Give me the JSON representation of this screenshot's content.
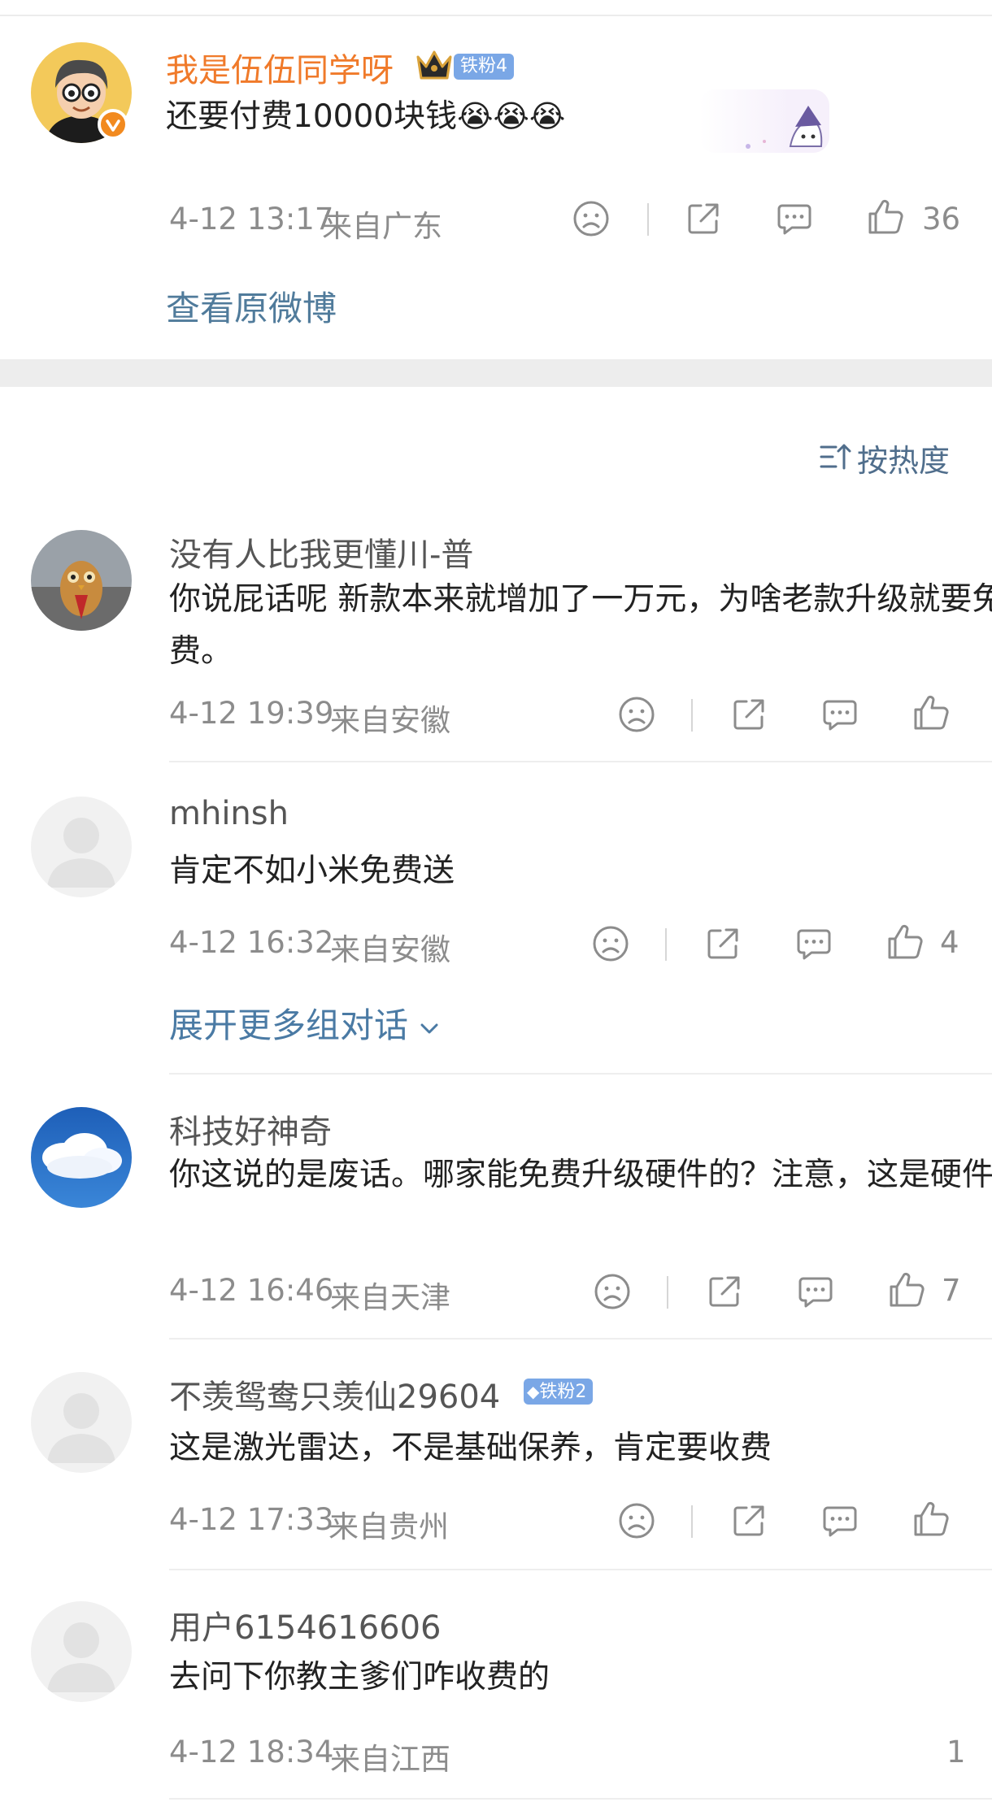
{
  "post": {
    "username": "我是伍伍同学呀",
    "fan_badge": "铁粉4",
    "text": "还要付费10000块钱",
    "emoji": "😭😭😭",
    "time": "4-12 13:17",
    "location": "来自广东",
    "likes": "36",
    "view_original": "查看原微博"
  },
  "sort": {
    "label": "按热度"
  },
  "comments": [
    {
      "username": "没有人比我更懂川-普",
      "text": "你说屁话呢 新款本来就增加了一万元，为啥老款升级就要免费。",
      "time": "4-12 19:39",
      "location": "来自安徽",
      "likes": ""
    },
    {
      "username": "mhinsh",
      "text": "肯定不如小米免费送",
      "time": "4-12 16:32",
      "location": "来自安徽",
      "likes": "4",
      "expand": "展开更多组对话"
    },
    {
      "username": "科技好神奇",
      "text": "你这说的是废话。哪家能免费升级硬件的？注意，这是硬件",
      "time": "4-12 16:46",
      "location": "来自天津",
      "likes": "7"
    },
    {
      "username": "不羡鸳鸯只羡仙29604",
      "fan_badge": "铁粉2",
      "text": "这是激光雷达，不是基础保养，肯定要收费",
      "time": "4-12 17:33",
      "location": "来自贵州",
      "likes": ""
    },
    {
      "username": "用户6154616606",
      "text": "去问下你教主爹们咋收费的",
      "time": "4-12 18:34",
      "location": "来自江西",
      "likes": "1"
    }
  ],
  "icons": [
    "sad-face-icon",
    "share-icon",
    "comment-icon",
    "thumbs-up-icon",
    "sort-icon",
    "chevron-down-icon",
    "verified-icon",
    "crown-icon"
  ],
  "colors": {
    "username_accent": "#f07a2a",
    "link": "#507b9b",
    "meta": "#8c8c8c",
    "badge": "#7aa7e6"
  }
}
